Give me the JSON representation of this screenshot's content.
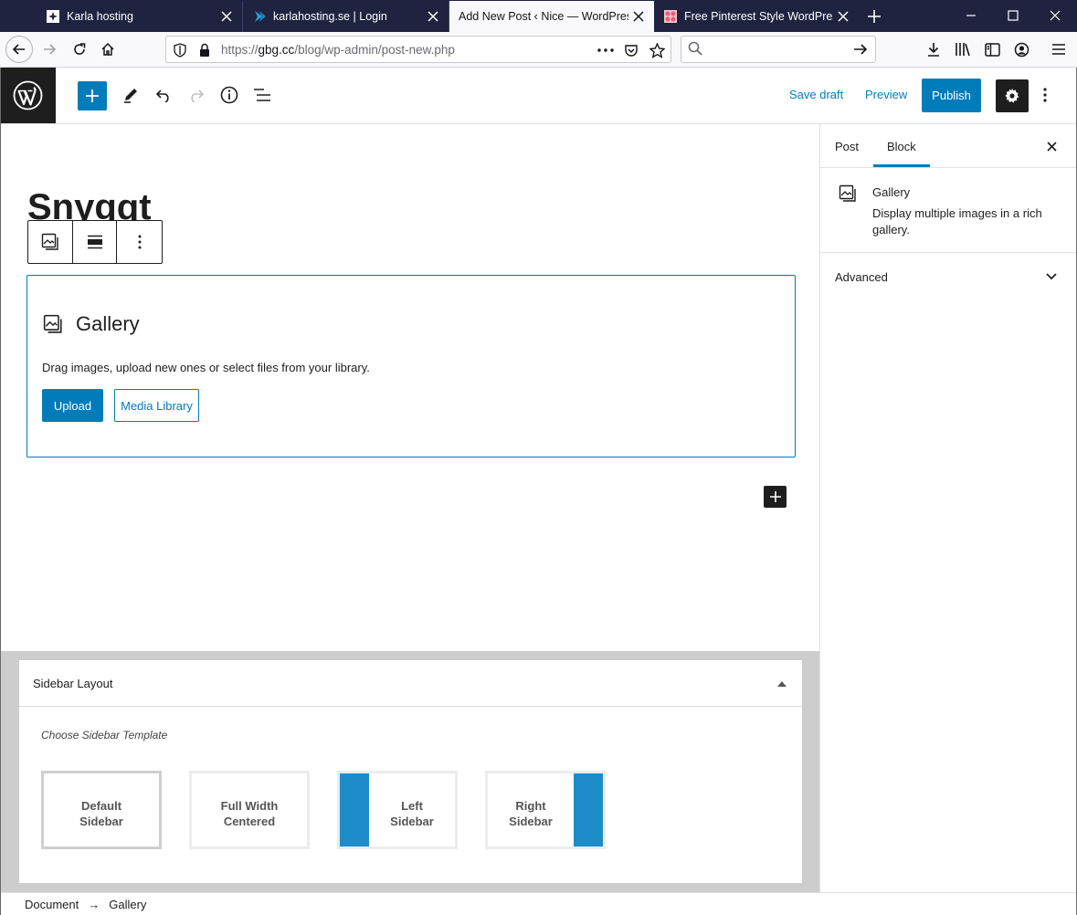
{
  "browser": {
    "tabs": [
      {
        "title": "Karla hosting",
        "favicon": "karla-favicon"
      },
      {
        "title": "karlahosting.se | Login",
        "favicon": "chevron-favicon"
      },
      {
        "title": "Add New Post ‹ Nice — WordPress",
        "favicon": "none",
        "active": true
      },
      {
        "title": "Free Pinterest Style WordPress T",
        "favicon": "pinterest-favicon"
      }
    ],
    "url_prefix": "https://",
    "url_domain": "gbg.cc",
    "url_path": "/blog/wp-admin/post-new.php",
    "search_placeholder": ""
  },
  "editor_header": {
    "save_draft": "Save draft",
    "preview": "Preview",
    "publish": "Publish"
  },
  "post": {
    "title": "Snygqt"
  },
  "gallery_block": {
    "title": "Gallery",
    "description": "Drag images, upload new ones or select files from your library.",
    "upload": "Upload",
    "media_library": "Media Library"
  },
  "metabox": {
    "title": "Sidebar Layout",
    "choose": "Choose Sidebar Template",
    "templates": [
      {
        "label": "Default\nSidebar"
      },
      {
        "label": "Full Width\nCentered"
      },
      {
        "label": "Left\nSidebar"
      },
      {
        "label": "Right\nSidebar"
      }
    ]
  },
  "sidebar": {
    "tab_post": "Post",
    "tab_block": "Block",
    "block_name": "Gallery",
    "block_description": "Display multiple images in a rich gallery.",
    "advanced": "Advanced"
  },
  "breadcrumb": {
    "document": "Document",
    "arrow": "→",
    "current": "Gallery"
  },
  "colors": {
    "accent": "#007cba",
    "tab_bar": "#202340",
    "template_bar": "#1e8cc8"
  }
}
